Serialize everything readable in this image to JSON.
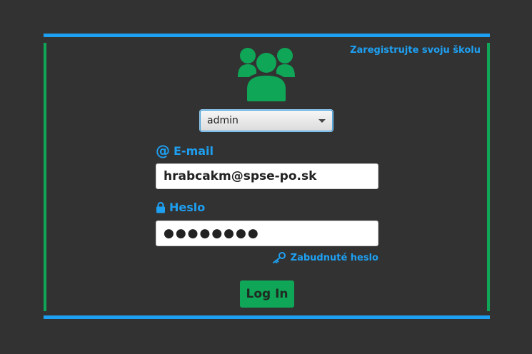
{
  "colors": {
    "background": "#323232",
    "accent_blue": "#1ea0f2",
    "accent_green": "#0fa657"
  },
  "header": {
    "register_link": "Zaregistrujte svoju školu"
  },
  "logo": {
    "icon": "users-group-icon"
  },
  "role_select": {
    "selected": "admin"
  },
  "email": {
    "label": "E-mail",
    "icon": "at-icon",
    "value": "hrabcakm@spse-po.sk"
  },
  "password": {
    "label": "Heslo",
    "icon": "lock-icon",
    "value": "●●●●●●●●"
  },
  "forgot_password": {
    "label": "Zabudnuté heslo",
    "icon": "key-icon"
  },
  "login_button": {
    "label": "Log In"
  }
}
